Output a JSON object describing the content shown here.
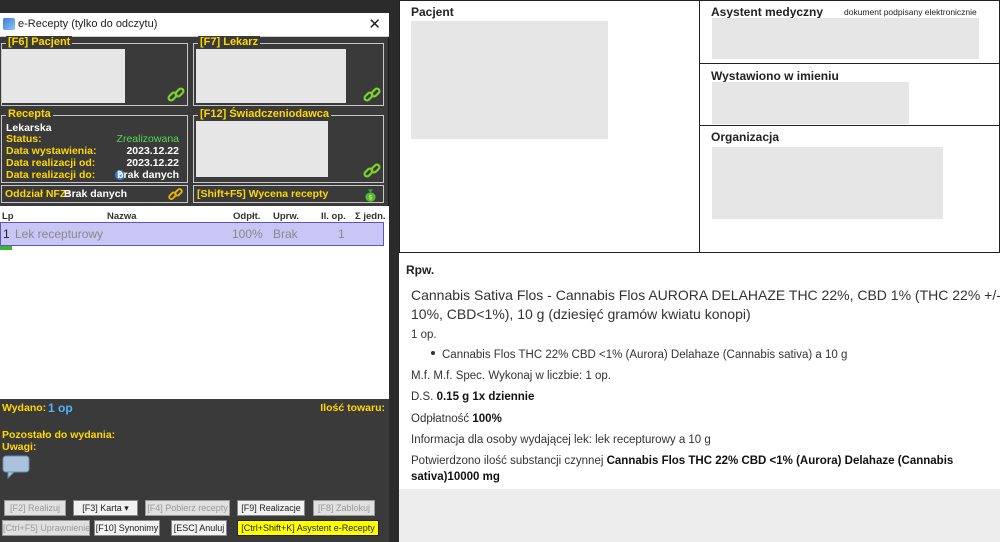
{
  "window": {
    "title": "e-Recepty (tylko do odczytu)",
    "close": "✕"
  },
  "panels": {
    "pacjent": "[F6] Pacjent",
    "lekarz": "[F7] Lekarz",
    "recepta": "Recepta",
    "swiadczeniodawca": "[F12] Świadczeniodawca"
  },
  "recepta": {
    "type": "Lekarska",
    "status_label": "Status:",
    "status_value": "Zrealizowana",
    "data_wystawienia_label": "Data wystawienia:",
    "data_wystawienia_value": "2023.12.22",
    "data_realizacji_od_label": "Data realizacji od:",
    "data_realizacji_od_value": "2023.12.22",
    "data_realizacji_do_label": "Data realizacji do:",
    "data_realizacji_do_value": "brak danych",
    "help_glyph": "?"
  },
  "oddzial": {
    "label": "Oddział NFZ:",
    "value": "Brak danych"
  },
  "wycena": "[Shift+F5] Wycena recepty",
  "grid": {
    "headers": [
      "Lp",
      "Nazwa",
      "Odpłt.",
      "Uprw.",
      "Il. op.",
      "Σ jedn."
    ],
    "row": {
      "lp": "1",
      "nazwa": "Lek recepturowy",
      "odplt": "100%",
      "uprw": "Brak",
      "ilop": "1"
    }
  },
  "bottom": {
    "wydano_label": "Wydano:",
    "wydano_value": "1 op",
    "ilosc_label": "Ilość towaru:",
    "pozostalo_label": "Pozostało do wydania:",
    "uwagi_label": "Uwagi:"
  },
  "buttons": {
    "realizuj": "[F2] Realizuj",
    "karta": "[F3] Karta ▾",
    "pobierz": "[F4] Pobierz recepty",
    "realizacje": "[F9] Realizacje",
    "zablokuj": "[F8] Zablokuj",
    "uprawnienie": "[Ctrl+F5] Uprawnienie",
    "synonimy": "[F10] Synonimy",
    "anuluj": "[ESC] Anuluj",
    "asystent": "[Ctrl+Shift+K] Asystent e-Recepty"
  },
  "doc": {
    "pacjent": "Pacjent",
    "asystent": "Asystent medyczny",
    "podpisany": "dokument podpisany elektronicznie",
    "wystawiono": "Wystawiono w imieniu",
    "organizacja": "Organizacja",
    "rpw": "Rpw.",
    "drug_line1": "Cannabis Sativa Flos - Cannabis Flos AURORA DELAHAZE THC 22%, CBD 1% (THC 22% +/-",
    "drug_line2": "10%, CBD<1%), 10 g (dziesięć gramów kwiatu konopi)",
    "op": "1 op.",
    "bullet": "Cannabis Flos THC 22% CBD <1% (Aurora) Delahaze (Cannabis sativa) a 10 g",
    "mf": "M.f. M.f. Spec. Wykonaj w liczbie: 1 op.",
    "ds_prefix": "D.S.",
    "ds_value": "0.15 g 1x dziennie",
    "odplatnosc_prefix": "Odpłatność",
    "odplatnosc_value": "100%",
    "informacja": "Informacja dla osoby wydającej lek: lek recepturowy a 10 g",
    "potwierdzono_prefix": "Potwierdzono ilość substancji czynnej",
    "potwierdzono_value1": "Cannabis Flos THC 22% CBD <1% (Aurora) Delahaze (Cannabis",
    "potwierdzono_value2": "sativa)10000 mg"
  },
  "colors": {
    "panel_title": "#ffd800",
    "status_green": "#55d655",
    "row_highlight": "#c8c6f4",
    "asystent_button": "#ffff00"
  },
  "icons": [
    "app-icon",
    "close-icon",
    "link-icon",
    "help-icon",
    "chain-icon",
    "money-bag-icon",
    "chat-icon",
    "bullet-icon"
  ]
}
